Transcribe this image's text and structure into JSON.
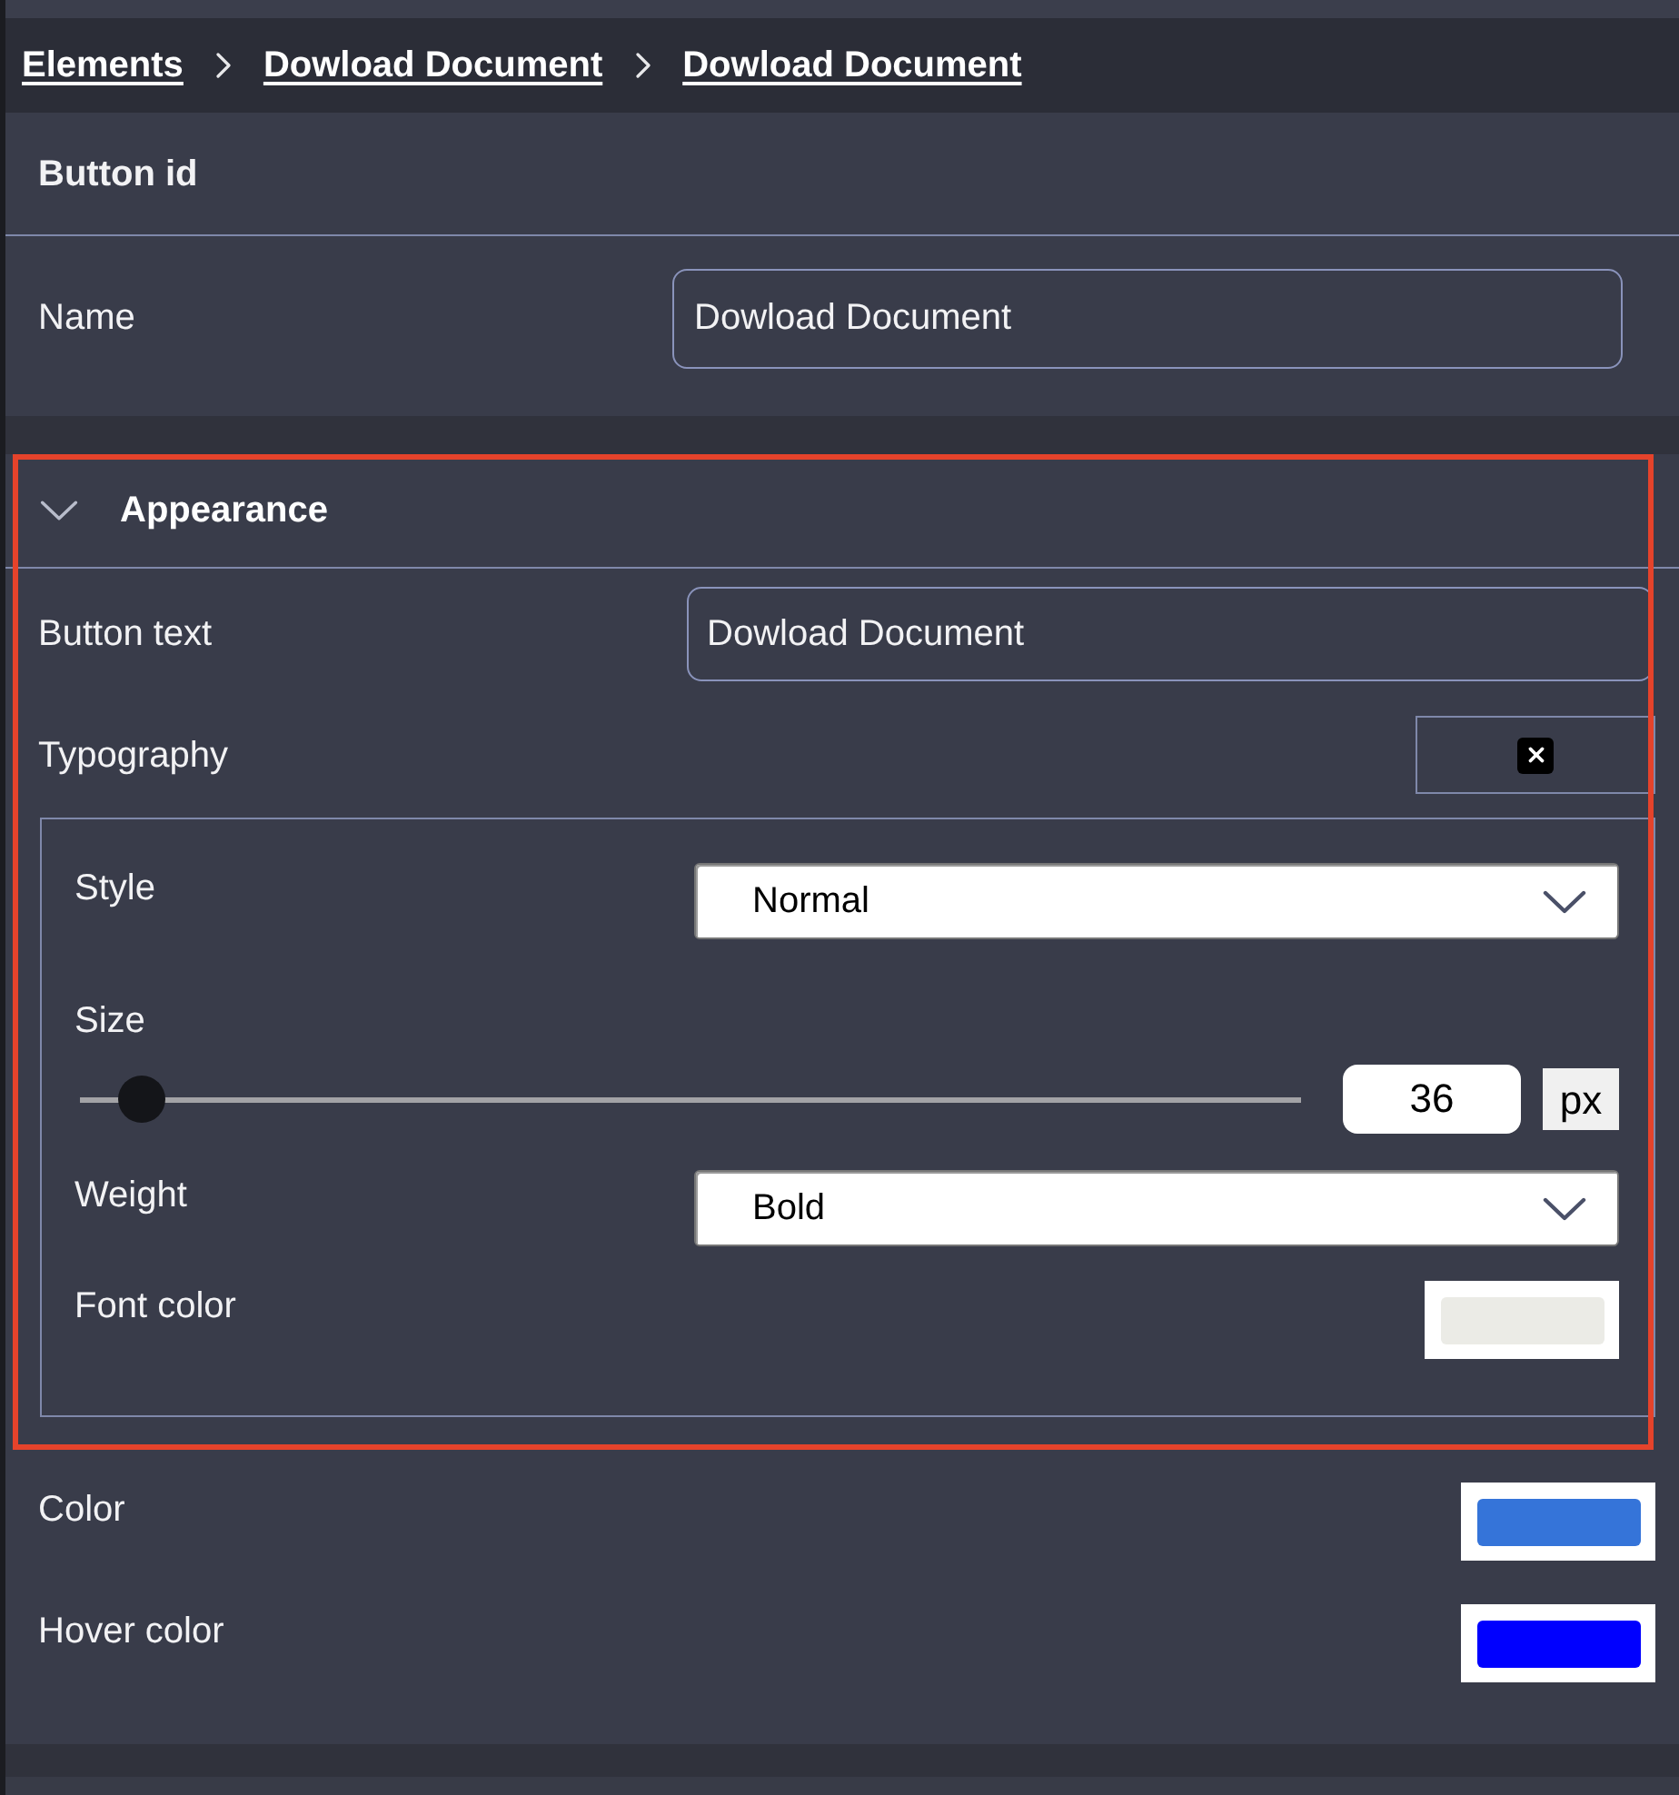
{
  "breadcrumb": [
    {
      "label": "Elements"
    },
    {
      "label": "Dowload Document"
    },
    {
      "label": "Dowload Document"
    }
  ],
  "button_id": {
    "title": "Button id"
  },
  "name_field": {
    "label": "Name",
    "value": "Dowload Document"
  },
  "appearance": {
    "title": "Appearance",
    "expanded": true,
    "highlighted": true,
    "button_text": {
      "label": "Button text",
      "value": "Dowload Document"
    },
    "typography": {
      "label": "Typography",
      "style": {
        "label": "Style",
        "value": "Normal"
      },
      "size": {
        "label": "Size",
        "level": 0.05,
        "value": "36",
        "unit": "px"
      },
      "weight": {
        "label": "Weight",
        "value": "Bold"
      },
      "font_color": {
        "label": "Font color",
        "color": "#ebebe6"
      }
    }
  },
  "colors": [
    {
      "label": "Color",
      "color": "#3574d9"
    },
    {
      "label": "Hover color",
      "color": "#0000ff"
    }
  ]
}
